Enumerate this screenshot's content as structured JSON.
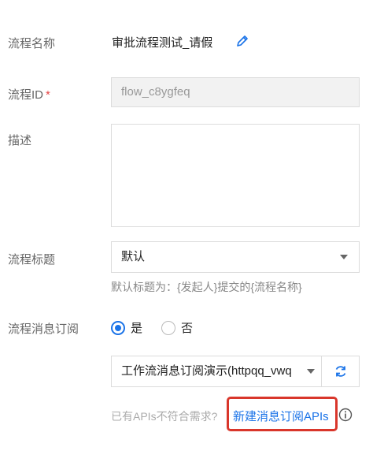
{
  "form": {
    "name_label": "流程名称",
    "name_value": "审批流程测试_请假",
    "id_label": "流程ID",
    "id_required_mark": "*",
    "id_value": "flow_c8ygfeq",
    "desc_label": "描述",
    "desc_value": "",
    "title_label": "流程标题",
    "title_value": "默认",
    "title_hint": "默认标题为：{发起人}提交的{流程名称}",
    "subscribe_label": "流程消息订阅",
    "subscribe_options": [
      {
        "label": "是",
        "checked": true
      },
      {
        "label": "否",
        "checked": false
      }
    ],
    "api_selected": "工作流消息订阅演示(httpqq_vwq",
    "api_note": "已有APIs不符合需求?",
    "new_api_link": "新建消息订阅APIs"
  },
  "colors": {
    "accent": "#1a73e8",
    "highlight": "#d9362b",
    "required": "#e54545"
  },
  "icons": [
    "edit-icon",
    "refresh-icon",
    "info-icon",
    "caret-down-icon"
  ]
}
